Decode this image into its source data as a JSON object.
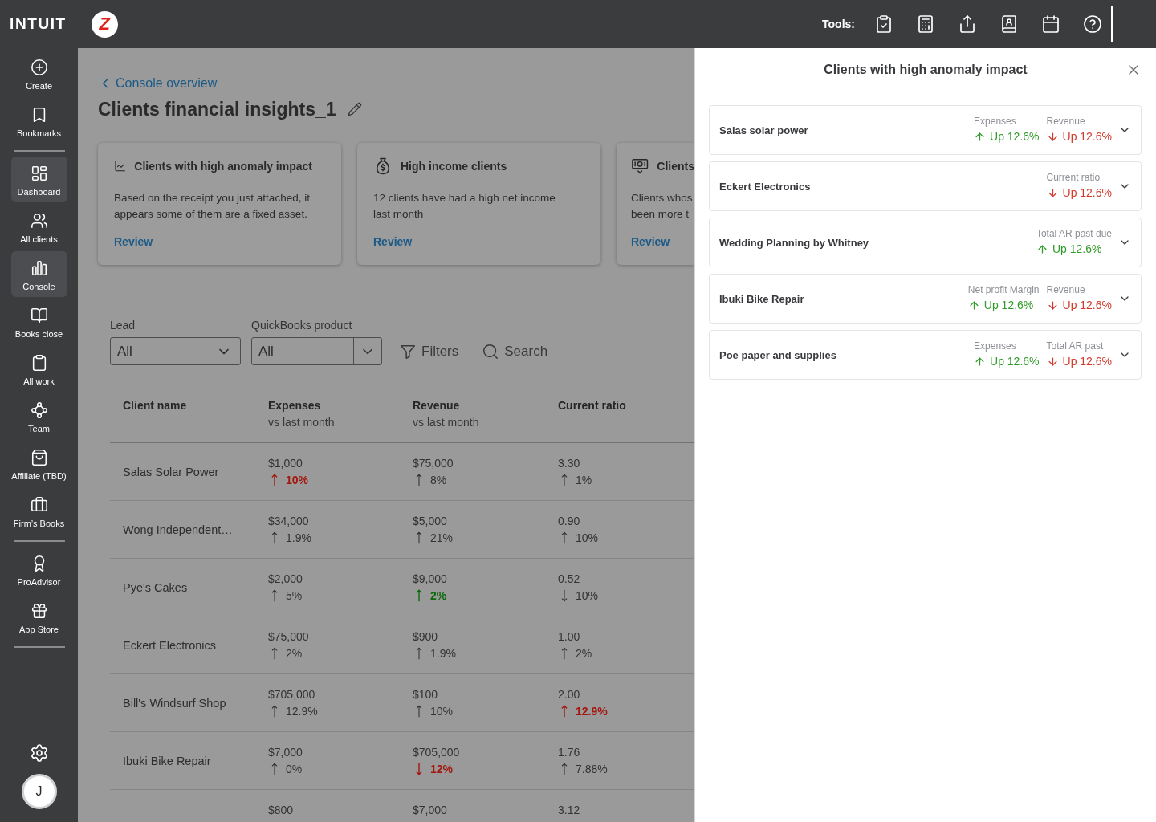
{
  "header": {
    "logo": "INTUIT",
    "badge": "Z",
    "tools_label": "Tools:"
  },
  "sidebar": {
    "sections": [
      {
        "items": [
          {
            "label": "Create",
            "selected": false
          },
          {
            "label": "Bookmarks",
            "selected": false
          }
        ]
      },
      {
        "items": [
          {
            "label": "Dashboard",
            "selected": true
          },
          {
            "label": "All clients",
            "selected": false
          },
          {
            "label": "Console",
            "selected": true
          },
          {
            "label": "Books close",
            "selected": false
          },
          {
            "label": "All work",
            "selected": false
          },
          {
            "label": "Team",
            "selected": false
          },
          {
            "label": "Affiliate (TBD)",
            "selected": false
          },
          {
            "label": "Firm’s Books",
            "selected": false
          }
        ]
      },
      {
        "items": [
          {
            "label": "ProAdvisor",
            "selected": false
          },
          {
            "label": "App Store",
            "selected": false
          }
        ]
      }
    ],
    "avatar": "J"
  },
  "page": {
    "back_link": "Console overview",
    "title": "Clients financial insights_1"
  },
  "insight_cards": [
    {
      "title": "Clients with high anomaly impact",
      "body": "Based on the receipt you just attached, it appears some of them are a fixed asset.",
      "action": "Review"
    },
    {
      "title": "High income clients",
      "body": "12 clients have had a high net income last month",
      "action": "Review"
    },
    {
      "title": "Clients",
      "body": "Clients whos\nbeen more t",
      "action": "Review"
    }
  ],
  "filters": {
    "selects": [
      {
        "kind": "plain",
        "label": "Lead",
        "value": "All"
      },
      {
        "kind": "split",
        "label": "QuickBooks product",
        "value": "All"
      }
    ],
    "buttons": [
      {
        "kind": "filter",
        "label": "Filters"
      },
      {
        "kind": "search",
        "label": "Search"
      }
    ]
  },
  "table": {
    "columns": [
      {
        "title": "Client name"
      },
      {
        "title": "Expenses",
        "subtitle": "vs last month"
      },
      {
        "title": "Revenue",
        "subtitle": "vs last month"
      },
      {
        "title": "Current ratio"
      }
    ],
    "rows": [
      {
        "cells": [
          {
            "text": "Salas Solar Power"
          },
          {
            "value": "$1,000",
            "change": {
              "text": "10%",
              "rising": true,
              "highlighted": true,
              "color": "#a3170e"
            }
          },
          {
            "value": "$75,000",
            "change": {
              "text": "8%",
              "rising": true,
              "highlighted": false,
              "color": "#333333"
            }
          },
          {
            "value": "3.30",
            "change": {
              "text": "1%",
              "rising": true,
              "highlighted": false,
              "color": "#333333"
            }
          }
        ]
      },
      {
        "cells": [
          {
            "text": "Wong Independent…"
          },
          {
            "value": "$34,000",
            "change": {
              "text": "1.9%",
              "rising": true,
              "highlighted": false,
              "color": "#333333"
            }
          },
          {
            "value": "$5,000",
            "change": {
              "text": "21%",
              "rising": true,
              "highlighted": false,
              "color": "#333333"
            }
          },
          {
            "value": "0.90",
            "change": {
              "text": "10%",
              "rising": true,
              "highlighted": false,
              "color": "#333333"
            }
          }
        ]
      },
      {
        "cells": [
          {
            "text": "Pye's Cakes"
          },
          {
            "value": "$2,000",
            "change": {
              "text": "5%",
              "rising": true,
              "highlighted": false,
              "color": "#333333"
            }
          },
          {
            "value": "$9,000",
            "change": {
              "text": "2%",
              "rising": true,
              "highlighted": true,
              "color": "#0d6a0d"
            }
          },
          {
            "value": "0.52",
            "change": {
              "text": "10%",
              "rising": false,
              "highlighted": false,
              "color": "#333333"
            }
          }
        ]
      },
      {
        "cells": [
          {
            "text": "Eckert Electronics"
          },
          {
            "value": "$75,000",
            "change": {
              "text": "2%",
              "rising": true,
              "highlighted": false,
              "color": "#333333"
            }
          },
          {
            "value": "$900",
            "change": {
              "text": "1.9%",
              "rising": true,
              "highlighted": false,
              "color": "#333333"
            }
          },
          {
            "value": "1.00",
            "change": {
              "text": "2%",
              "rising": true,
              "highlighted": false,
              "color": "#333333"
            }
          }
        ]
      },
      {
        "cells": [
          {
            "text": "Bill's Windsurf Shop"
          },
          {
            "value": "$705,000",
            "change": {
              "text": "12.9%",
              "rising": true,
              "highlighted": false,
              "color": "#333333"
            }
          },
          {
            "value": "$100",
            "change": {
              "text": "10%",
              "rising": true,
              "highlighted": false,
              "color": "#333333"
            }
          },
          {
            "value": "2.00",
            "change": {
              "text": "12.9%",
              "rising": true,
              "highlighted": true,
              "color": "#a3170e"
            }
          }
        ]
      },
      {
        "cells": [
          {
            "text": "Ibuki Bike Repair"
          },
          {
            "value": "$7,000",
            "change": {
              "text": "0%",
              "rising": true,
              "highlighted": false,
              "color": "#333333"
            }
          },
          {
            "value": "$705,000",
            "change": {
              "text": "12%",
              "rising": false,
              "highlighted": true,
              "color": "#a3170e"
            }
          },
          {
            "value": "1.76",
            "change": {
              "text": "7.88%",
              "rising": true,
              "highlighted": false,
              "color": "#333333"
            }
          }
        ]
      },
      {
        "cells": [
          {
            "text": ""
          },
          {
            "value": "$800"
          },
          {
            "value": "$7,000"
          },
          {
            "value": "3.12"
          }
        ]
      }
    ]
  },
  "panel": {
    "title": "Clients with high anomaly impact",
    "clients": [
      {
        "name": "Salas solar power",
        "expanded": false,
        "metrics": [
          {
            "label": "Expenses",
            "rising": true,
            "color": "#2e9a27",
            "value": "Up 12.6%"
          },
          {
            "label": "Revenue",
            "rising": false,
            "color": "#d1382c",
            "value": "Up 12.6%"
          }
        ]
      },
      {
        "name": "Eckert Electronics",
        "expanded": false,
        "metrics": [
          {
            "label": "Current ratio",
            "rising": false,
            "color": "#d1382c",
            "value": "Up 12.6%"
          }
        ]
      },
      {
        "name": "Wedding Planning by Whitney",
        "expanded": false,
        "metrics": [
          {
            "label": "Total AR past due",
            "rising": true,
            "color": "#2e9a27",
            "value": "Up 12.6%"
          }
        ]
      },
      {
        "name": "Ibuki Bike Repair",
        "expanded": false,
        "metrics": [
          {
            "label": "Net profit Margin",
            "rising": true,
            "color": "#2e9a27",
            "value": "Up 12.6%"
          },
          {
            "label": "Revenue",
            "rising": false,
            "color": "#d1382c",
            "value": "Up 12.6%"
          }
        ]
      },
      {
        "name": "Poe paper and supplies",
        "expanded": false,
        "metrics": [
          {
            "label": "Expenses",
            "rising": true,
            "color": "#2e9a27",
            "value": "Up 12.6%"
          },
          {
            "label": "Total AR past",
            "rising": false,
            "color": "#d1382c",
            "value": "Up 12.6%"
          }
        ]
      }
    ]
  }
}
